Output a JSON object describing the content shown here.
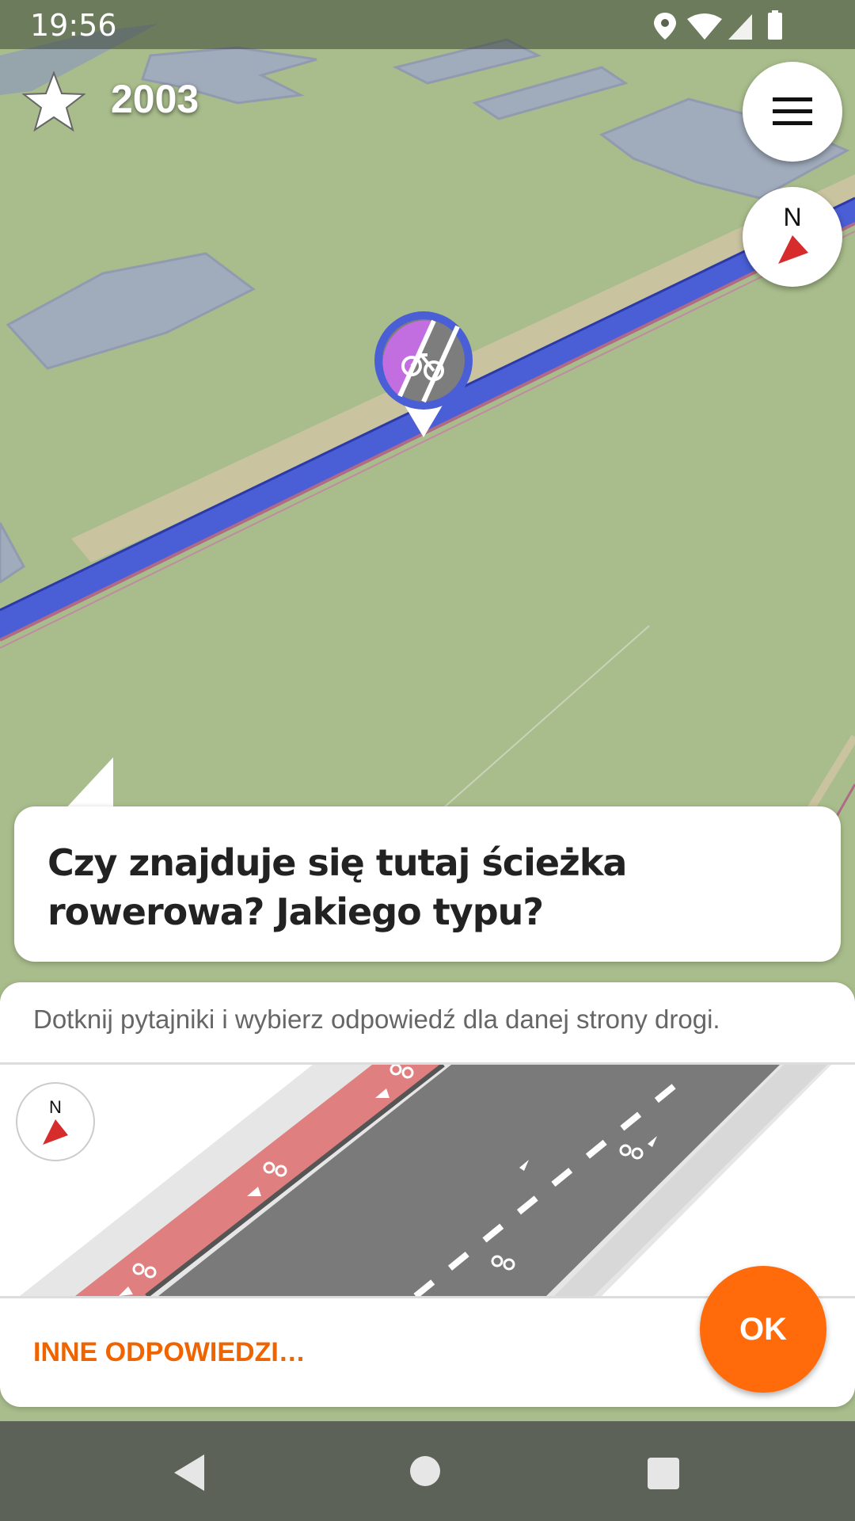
{
  "status_bar": {
    "time": "19:56"
  },
  "header": {
    "star_count": "2003",
    "compass_label": "N"
  },
  "quest": {
    "question": "Czy znajduje się tutaj ścieżka rowerowa? Jakiego typu?",
    "hint": "Dotknij pytajniki i wybierz odpowiedź dla danej strony drogi.",
    "compass_label": "N",
    "other_answers": "INNE ODPOWIEDZI…",
    "ok": "OK"
  },
  "colors": {
    "accent": "#ff6a0a",
    "accent_text": "#f06400",
    "map_green": "#a9bd8c",
    "cycleway_blue": "#4a5fd6",
    "bike_lane_red": "#e07f7f",
    "marker_purple": "#c36ee0"
  },
  "icons": [
    "star-icon",
    "menu-icon",
    "compass-icon",
    "bicycle-icon",
    "location-icon",
    "wifi-icon",
    "signal-icon",
    "battery-icon",
    "back-icon",
    "home-icon",
    "recents-icon"
  ]
}
